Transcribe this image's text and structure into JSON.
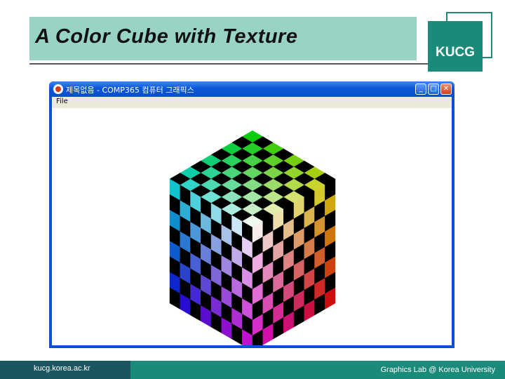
{
  "slide": {
    "title": "A Color Cube with Texture",
    "logo": "KUCG",
    "footer_url": "kucg.korea.ac.kr",
    "footer_lab": "Graphics Lab @ Korea University"
  },
  "window": {
    "title": "제목없음 - COMP365 컴퓨터 그래픽스",
    "buttons": {
      "minimize": "_",
      "maximize": "□",
      "close": "✕"
    },
    "icon": "app-icon",
    "menu": [
      "File"
    ]
  },
  "scene": {
    "object": "color-cube",
    "texture": "checkerboard",
    "checker_cells": 8,
    "checker_dark": "#000000",
    "corner_colors": {
      "top": "#00cc00",
      "left_top": "#00cccc",
      "right_top": "#cccc00",
      "center": "#ffffff",
      "left_bottom": "#0000cc",
      "right_bottom": "#cc0000",
      "bottom": "#cc00cc"
    }
  },
  "colors": {
    "title_bg": "#99d3c6",
    "accent": "#1a8a79",
    "footer_dark": "#1a5560",
    "window_blue": "#0a50d6",
    "menubar": "#ece9d8"
  }
}
